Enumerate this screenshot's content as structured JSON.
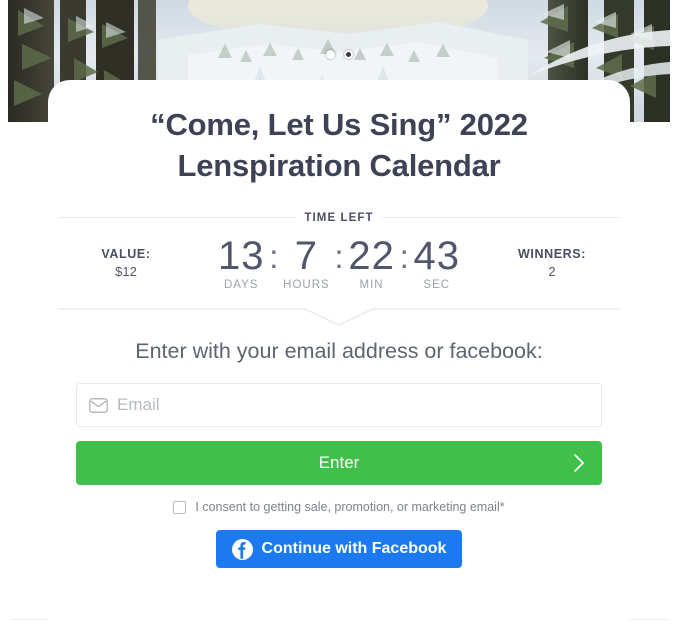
{
  "hero": {
    "alt_description": "snowy-forest-winter-landscape-photo",
    "carousel": {
      "dots": [
        {
          "name": "slide-1",
          "state": "active"
        },
        {
          "name": "slide-2",
          "state": "inactive"
        }
      ]
    }
  },
  "card": {
    "title_line1": "“Come, Let Us Sing” 2022",
    "title_line2": "Lenspiration Calendar",
    "time_left_label": "TIME LEFT",
    "value": {
      "label": "VALUE:",
      "amount": "$12"
    },
    "winners": {
      "label": "WINNERS:",
      "count": "2"
    },
    "countdown": {
      "separator": ":",
      "units": [
        {
          "value": "13",
          "caption": "DAYS"
        },
        {
          "value": "7",
          "caption": "HOURS"
        },
        {
          "value": "22",
          "caption": "MIN"
        },
        {
          "value": "43",
          "caption": "SEC"
        }
      ]
    },
    "form": {
      "subhead": "Enter with your email address or facebook:",
      "email_placeholder": "Email",
      "email_value": "",
      "enter_label": "Enter",
      "consent_label": "I consent to getting sale, promotion, or marketing email*",
      "consent_checked": false,
      "facebook_label": "Continue with Facebook"
    }
  },
  "colors": {
    "green_button": "#40c04b",
    "facebook_blue": "#1b7aef",
    "title_text": "#3d4255",
    "body_text": "#5f6472",
    "muted_text": "#9aa0ad",
    "divider": "#ececef"
  }
}
